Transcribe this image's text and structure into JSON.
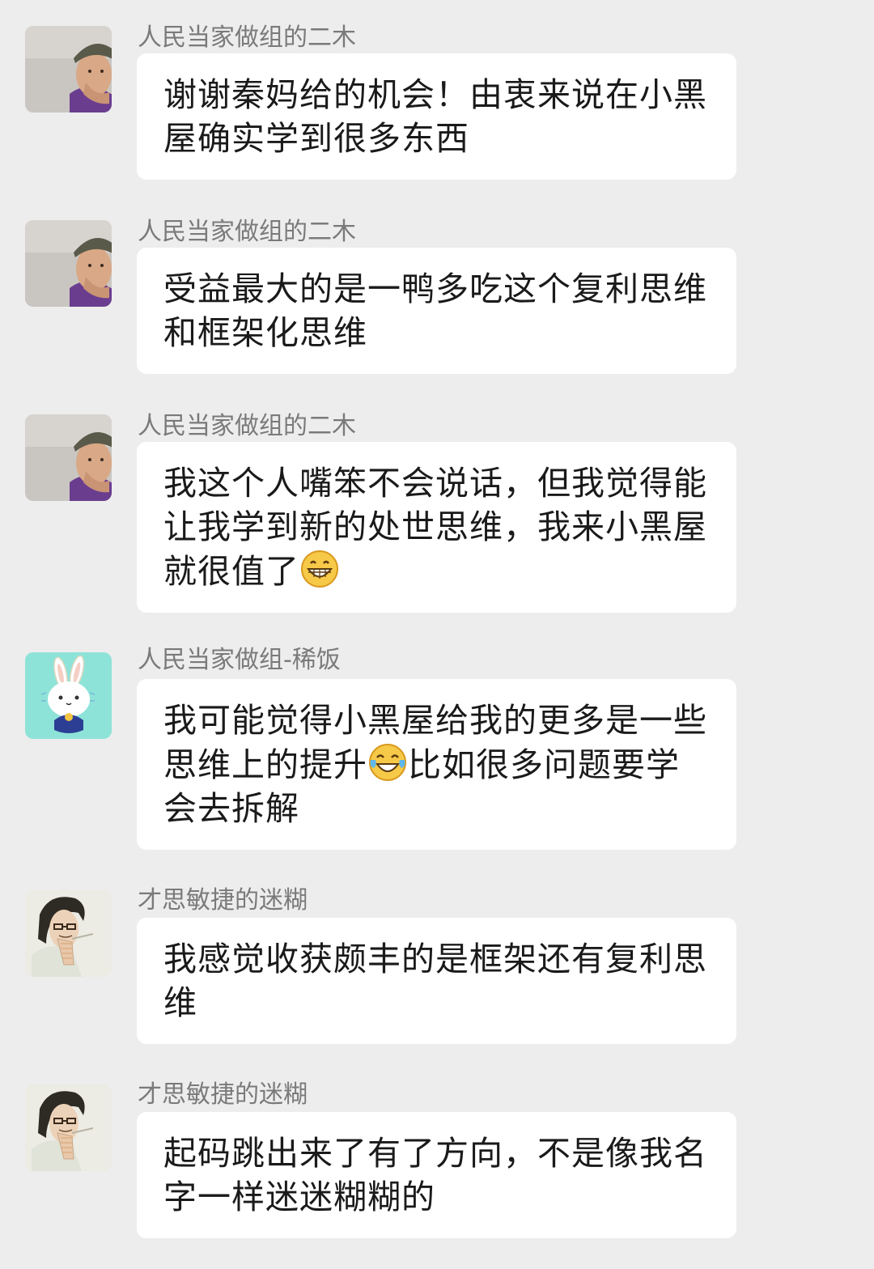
{
  "messages": [
    {
      "sender": "人民当家做组的二木",
      "avatar_icon": "man-with-cap-avatar-icon",
      "text": "谢谢秦妈给的机会！由衷来说在小黑屋确实学到很多东西"
    },
    {
      "sender": "人民当家做组的二木",
      "avatar_icon": "man-with-cap-avatar-icon",
      "text": "受益最大的是一鸭多吃这个复利思维和框架化思维"
    },
    {
      "sender": "人民当家做组的二木",
      "avatar_icon": "man-with-cap-avatar-icon",
      "text_before_emoji": "我这个人嘴笨不会说话，但我觉得能让我学到新的处世思维，我来小黑屋就很值了",
      "emoji_icon": "grinning-face-emoji-icon"
    },
    {
      "sender": "人民当家做组-稀饭",
      "avatar_icon": "bunny-avatar-icon",
      "text_before_emoji": "我可能觉得小黑屋给我的更多是一些思维上的提升",
      "emoji_icon": "tears-of-joy-emoji-icon",
      "text_after_emoji": "比如很多问题要学会去拆解"
    },
    {
      "sender": "才思敏捷的迷糊",
      "avatar_icon": "man-with-glasses-avatar-icon",
      "text": "我感觉收获颇丰的是框架还有复利思维"
    },
    {
      "sender": "才思敏捷的迷糊",
      "avatar_icon": "man-with-glasses-avatar-icon",
      "text": "起码跳出来了有了方向，不是像我名字一样迷迷糊糊的"
    }
  ],
  "colors": {
    "background": "#ededed",
    "bubble": "#ffffff",
    "sender_text": "#7a7a7a",
    "message_text": "#1a1a1a"
  }
}
